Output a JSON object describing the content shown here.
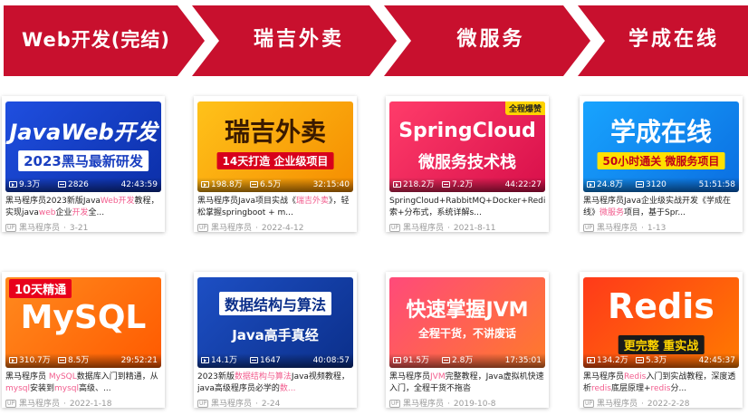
{
  "roadmap": {
    "steps": [
      {
        "label": "Web开发(完结)"
      },
      {
        "label": "瑞吉外卖"
      },
      {
        "label": "微服务"
      },
      {
        "label": "学成在线"
      }
    ],
    "color": "#c8102e"
  },
  "courses": [
    {
      "thumb_title": "JavaWeb开发",
      "thumb_sub": "2023黑马最新研发",
      "badge": "",
      "plays": "9.3万",
      "danmaku": "2826",
      "duration": "42:43:59",
      "desc_a": "黑马程序员2023新版Java",
      "desc_h1": "Web开发",
      "desc_b": "教程，实现java",
      "desc_h2": "web",
      "desc_c": "企业",
      "desc_h3": "开发",
      "desc_d": "全...",
      "author": "黑马程序员",
      "date": "3-21"
    },
    {
      "thumb_title": "瑞吉外卖",
      "thumb_sub": "14天打造 企业级项目",
      "badge": "",
      "plays": "198.8万",
      "danmaku": "6.5万",
      "duration": "32:15:40",
      "desc_a": "黑马程序员Java项目实战《",
      "desc_h1": "瑞吉外卖",
      "desc_b": "》，轻松掌握springboot + m...",
      "desc_h2": "",
      "desc_c": "",
      "desc_h3": "",
      "desc_d": "",
      "author": "黑马程序员",
      "date": "2022-4-12"
    },
    {
      "thumb_title": "SpringCloud",
      "thumb_sub": "微服务技术栈",
      "badge": "全程爆赞",
      "plays": "218.2万",
      "danmaku": "7.2万",
      "duration": "44:22:27",
      "desc_a": "SpringCloud+RabbitMQ+Docker+Redis+搜索+分布式，系统详解s...",
      "desc_h1": "",
      "desc_b": "",
      "desc_h2": "",
      "desc_c": "",
      "desc_h3": "",
      "desc_d": "",
      "author": "黑马程序员",
      "date": "2021-8-11"
    },
    {
      "thumb_title": "学成在线",
      "thumb_sub": "50小时通关 微服务项目",
      "badge": "",
      "plays": "24.8万",
      "danmaku": "3120",
      "duration": "51:51:58",
      "desc_a": "黑马程序员Java企业级实战开发《学成在线》",
      "desc_h1": "微服务",
      "desc_b": "项目，基于Spr...",
      "desc_h2": "",
      "desc_c": "",
      "desc_h3": "",
      "desc_d": "",
      "author": "黑马程序员",
      "date": "1-13"
    },
    {
      "thumb_title": "MySQL",
      "thumb_sub": "10天精通",
      "badge": "",
      "plays": "310.7万",
      "danmaku": "8.5万",
      "duration": "29:52:21",
      "desc_a": "黑马程序员 ",
      "desc_h1": "MySQL",
      "desc_b": "数据库入门到精通，从",
      "desc_h2": "mysql",
      "desc_c": "安装到",
      "desc_h3": "mysql",
      "desc_d": "高级、...",
      "author": "黑马程序员",
      "date": "2022-1-18"
    },
    {
      "thumb_title": "数据结构与算法",
      "thumb_sub": "Java高手真经",
      "badge": "",
      "plays": "14.1万",
      "danmaku": "1647",
      "duration": "40:08:57",
      "desc_a": "2023新版",
      "desc_h1": "数据结构与算法",
      "desc_b": "Java视频教程，java高级程序员必学的",
      "desc_h2": "数...",
      "desc_c": "",
      "desc_h3": "",
      "desc_d": "",
      "author": "黑马程序员",
      "date": "2-24"
    },
    {
      "thumb_title": "快速掌握JVM",
      "thumb_sub": "全程干货，不讲废话",
      "badge": "",
      "plays": "91.5万",
      "danmaku": "2.8万",
      "duration": "17:35:01",
      "desc_a": "黑马程序员",
      "desc_h1": "JVM",
      "desc_b": "完整教程，Java虚拟机快速入门，全程干货不拖沓",
      "desc_h2": "",
      "desc_c": "",
      "desc_h3": "",
      "desc_d": "",
      "author": "黑马程序员",
      "date": "2019-10-8"
    },
    {
      "thumb_title": "Redis",
      "thumb_sub": "更完整 重实战",
      "badge": "",
      "plays": "134.2万",
      "danmaku": "5.3万",
      "duration": "42:45:37",
      "desc_a": "黑马程序员",
      "desc_h1": "Redis",
      "desc_b": "入门到实战教程，深度透析",
      "desc_h2": "redis",
      "desc_c": "底层原理+",
      "desc_h3": "redis",
      "desc_d": "分...",
      "author": "黑马程序员",
      "date": "2022-2-28"
    }
  ]
}
